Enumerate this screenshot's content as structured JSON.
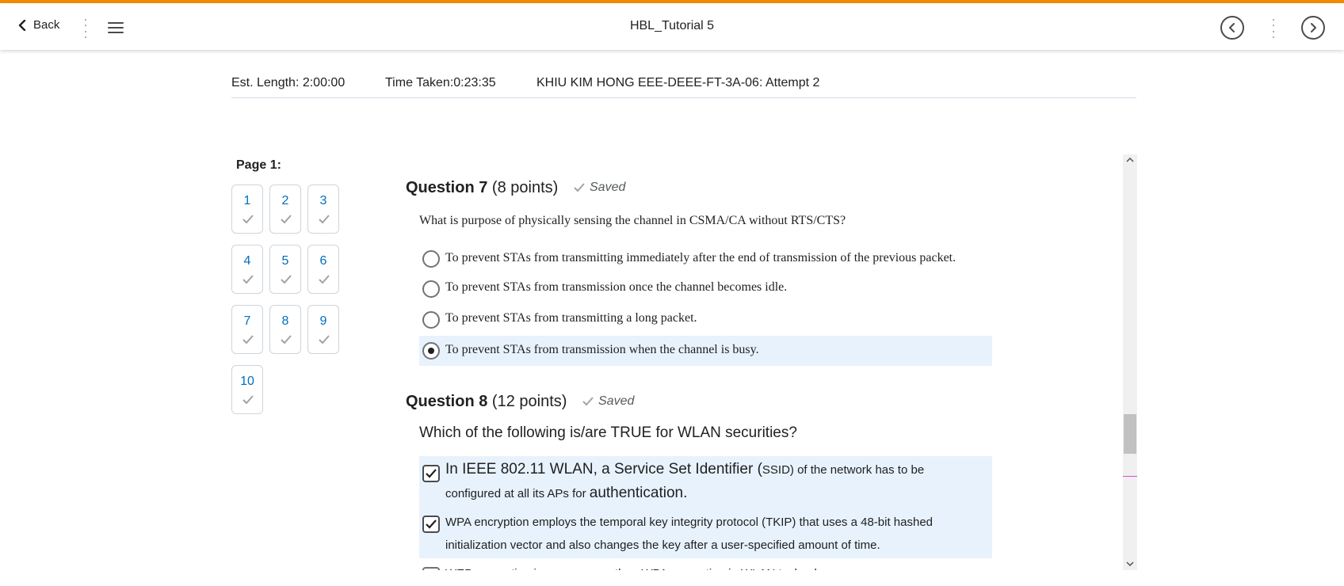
{
  "header": {
    "back_label": "Back",
    "title": "HBL_Tutorial 5"
  },
  "info": {
    "est_length": "Est. Length: 2:00:00",
    "time_taken": "Time Taken:0:23:35",
    "attempt": "KHIU KIM HONG EEE-DEEE-FT-3A-06: Attempt 2"
  },
  "nav": {
    "page_label": "Page 1:",
    "questions": [
      "1",
      "2",
      "3",
      "4",
      "5",
      "6",
      "7",
      "8",
      "9",
      "10"
    ]
  },
  "q7": {
    "title": "Question 7",
    "points": "(8 points)",
    "saved": "Saved",
    "text": "What is purpose of physically sensing the channel in CSMA/CA without RTS/CTS?",
    "options": [
      "To prevent STAs from transmitting immediately after the end of transmission of the previous packet.",
      "To prevent STAs from transmission once the channel becomes idle.",
      "To prevent STAs from transmitting a long packet.",
      "To prevent STAs from transmission when the channel is busy."
    ],
    "selected_index": 3
  },
  "q8": {
    "title": "Question 8",
    "points": "(12 points)",
    "saved": "Saved",
    "text": "Which of the following is/are TRUE for WLAN securities?",
    "opt1": {
      "a": "In IEEE 802.11 WLAN, a Service Set Identifier (",
      "b": "SSID) of the network has to be",
      "c": "configured at all its APs for ",
      "d": "authentication."
    },
    "opt2": {
      "line1": "WPA encryption employs the temporal key integrity protocol (TKIP) that uses a 48-bit hashed",
      "line2": "initialization vector and also changes the key after a user-specified amount of time."
    },
    "opt3_partial": "WEP encryption is more secure than WPA encryption in WLAN technology.",
    "checked": [
      true,
      true,
      false
    ]
  }
}
